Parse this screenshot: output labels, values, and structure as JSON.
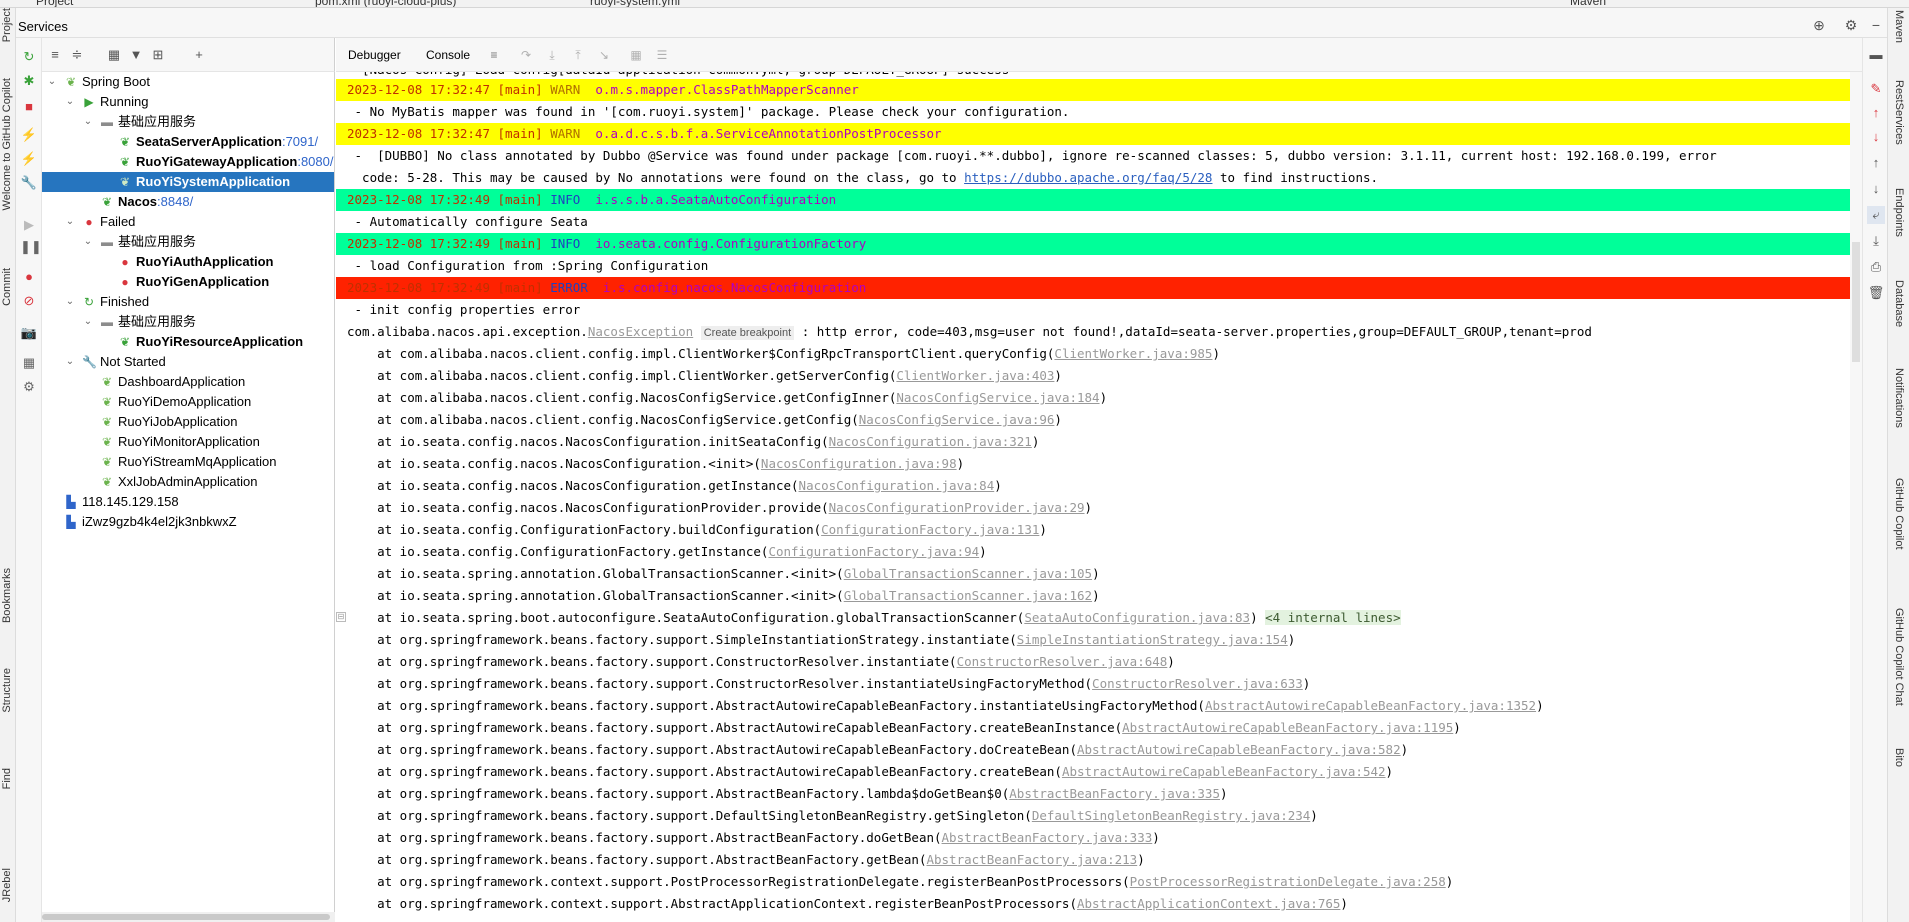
{
  "top_tabs": {
    "project": "Project",
    "pom": "pom.xml (ruoyi-cloud-plus)",
    "yml": "ruoyi-system.yml",
    "maven": "Maven"
  },
  "services": {
    "title": "Services"
  },
  "left_sidebar": {
    "project": "Project",
    "welcome": "Welcome to GitHub Copilot",
    "commit": "Commit",
    "bookmarks": "Bookmarks",
    "structure": "Structure",
    "find": "Find",
    "jrebel": "JRebel"
  },
  "right_sidebar": {
    "maven": "Maven",
    "rest": "RestServices",
    "endpoints": "Endpoints",
    "database": "Database",
    "notifications": "Notifications",
    "copilot": "GitHub Copilot",
    "copilot_chat": "GitHub Copilot Chat",
    "bito": "Bito"
  },
  "tree": {
    "spring_boot": "Spring Boot",
    "running": "Running",
    "group1": "基础应用服务",
    "seata": "SeataServerApplication",
    "seata_port": ":7091/",
    "gateway": "RuoYiGatewayApplication",
    "gateway_port": ":8080/",
    "system": "RuoYiSystemApplication",
    "nacos": "Nacos",
    "nacos_port": ":8848/",
    "failed": "Failed",
    "group2": "基础应用服务",
    "auth": "RuoYiAuthApplication",
    "gen": "RuoYiGenApplication",
    "finished": "Finished",
    "group3": "基础应用服务",
    "resource": "RuoYiResourceApplication",
    "not_started": "Not Started",
    "dashboard": "DashboardApplication",
    "demo": "RuoYiDemoApplication",
    "job": "RuoYiJobApplication",
    "monitor": "RuoYiMonitorApplication",
    "stream": "RuoYiStreamMqApplication",
    "xxl": "XxlJobAdminApplication",
    "ip": "118.145.129.158",
    "host": "iZwz9gzb4k4el2jk3nbkwxZ"
  },
  "console_tabs": {
    "debugger": "Debugger",
    "console": "Console"
  },
  "console": {
    "l0": "  [Nacos Config] Load config[dataId=application-common.yml, group=DEFAULT_GROUP] success",
    "l1_ts": "2023-12-08 17:32:47",
    "l1_thread": "[main]",
    "l1_level": "WARN",
    "l1_logger": "o.m.s.mapper.ClassPathMapperScanner",
    "l2": " - No MyBatis mapper was found in '[com.ruoyi.system]' package. Please check your configuration.",
    "l3_ts": "2023-12-08 17:32:47",
    "l3_thread": "[main]",
    "l3_level": "WARN",
    "l3_logger": "o.a.d.c.s.b.f.a.ServiceAnnotationPostProcessor",
    "l4": " -  [DUBBO] No class annotated by Dubbo @Service was found under package [com.ruoyi.**.dubbo], ignore re-scanned classes: 5, dubbo version: 3.1.11, current host: 192.168.0.199, error",
    "l5a": "  code: 5-28. This may be caused by No annotations were found on the class, go to ",
    "l5_link": "https://dubbo.apache.org/faq/5/28",
    "l5b": " to find instructions.",
    "l6_ts": "2023-12-08 17:32:49",
    "l6_thread": "[main]",
    "l6_level": "INFO",
    "l6_logger": "i.s.s.b.a.SeataAutoConfiguration",
    "l7": " - Automatically configure Seata",
    "l8_ts": "2023-12-08 17:32:49",
    "l8_thread": "[main]",
    "l8_level": "INFO",
    "l8_logger": "io.seata.config.ConfigurationFactory",
    "l9": " - load Configuration from :Spring Configuration",
    "l10_ts": "2023-12-08 17:32:49",
    "l10_thread": "[main]",
    "l10_level": "ERROR",
    "l10_logger": "i.s.config.nacos.NacosConfiguration",
    "l11": " - init config properties error",
    "exc_prefix": "com.alibaba.nacos.api.exception.",
    "exc_class": "NacosException",
    "exc_bp": "Create breakpoint",
    "exc_msg": " : http error, code=403,msg=user not found!,dataId=seata-server.properties,group=DEFAULT_GROUP,tenant=prod",
    "stack": [
      {
        "at": "    at com.alibaba.nacos.client.config.impl.ClientWorker$ConfigRpcTransportClient.queryConfig(",
        "src": "ClientWorker.java:985",
        "end": ")"
      },
      {
        "at": "    at com.alibaba.nacos.client.config.impl.ClientWorker.getServerConfig(",
        "src": "ClientWorker.java:403",
        "end": ")"
      },
      {
        "at": "    at com.alibaba.nacos.client.config.NacosConfigService.getConfigInner(",
        "src": "NacosConfigService.java:184",
        "end": ")"
      },
      {
        "at": "    at com.alibaba.nacos.client.config.NacosConfigService.getConfig(",
        "src": "NacosConfigService.java:96",
        "end": ")"
      },
      {
        "at": "    at io.seata.config.nacos.NacosConfiguration.initSeataConfig(",
        "src": "NacosConfiguration.java:321",
        "end": ")"
      },
      {
        "at": "    at io.seata.config.nacos.NacosConfiguration.<init>(",
        "src": "NacosConfiguration.java:98",
        "end": ")"
      },
      {
        "at": "    at io.seata.config.nacos.NacosConfiguration.getInstance(",
        "src": "NacosConfiguration.java:84",
        "end": ")"
      },
      {
        "at": "    at io.seata.config.nacos.NacosConfigurationProvider.provide(",
        "src": "NacosConfigurationProvider.java:29",
        "end": ")"
      },
      {
        "at": "    at io.seata.config.ConfigurationFactory.buildConfiguration(",
        "src": "ConfigurationFactory.java:131",
        "end": ")"
      },
      {
        "at": "    at io.seata.config.ConfigurationFactory.getInstance(",
        "src": "ConfigurationFactory.java:94",
        "end": ")"
      },
      {
        "at": "    at io.seata.spring.annotation.GlobalTransactionScanner.<init>(",
        "src": "GlobalTransactionScanner.java:105",
        "end": ")"
      },
      {
        "at": "    at io.seata.spring.annotation.GlobalTransactionScanner.<init>(",
        "src": "GlobalTransactionScanner.java:162",
        "end": ")"
      },
      {
        "at": "    at io.seata.spring.boot.autoconfigure.SeataAutoConfiguration.globalTransactionScanner(",
        "src": "SeataAutoConfiguration.java:83",
        "end": ") ",
        "extra": "<4 internal lines>"
      },
      {
        "at": "    at org.springframework.beans.factory.support.SimpleInstantiationStrategy.instantiate(",
        "src": "SimpleInstantiationStrategy.java:154",
        "end": ")"
      },
      {
        "at": "    at org.springframework.beans.factory.support.ConstructorResolver.instantiate(",
        "src": "ConstructorResolver.java:648",
        "end": ")"
      },
      {
        "at": "    at org.springframework.beans.factory.support.ConstructorResolver.instantiateUsingFactoryMethod(",
        "src": "ConstructorResolver.java:633",
        "end": ")"
      },
      {
        "at": "    at org.springframework.beans.factory.support.AbstractAutowireCapableBeanFactory.instantiateUsingFactoryMethod(",
        "src": "AbstractAutowireCapableBeanFactory.java:1352",
        "end": ")"
      },
      {
        "at": "    at org.springframework.beans.factory.support.AbstractAutowireCapableBeanFactory.createBeanInstance(",
        "src": "AbstractAutowireCapableBeanFactory.java:1195",
        "end": ")"
      },
      {
        "at": "    at org.springframework.beans.factory.support.AbstractAutowireCapableBeanFactory.doCreateBean(",
        "src": "AbstractAutowireCapableBeanFactory.java:582",
        "end": ")"
      },
      {
        "at": "    at org.springframework.beans.factory.support.AbstractAutowireCapableBeanFactory.createBean(",
        "src": "AbstractAutowireCapableBeanFactory.java:542",
        "end": ")"
      },
      {
        "at": "    at org.springframework.beans.factory.support.AbstractBeanFactory.lambda$doGetBean$0(",
        "src": "AbstractBeanFactory.java:335",
        "end": ")"
      },
      {
        "at": "    at org.springframework.beans.factory.support.DefaultSingletonBeanRegistry.getSingleton(",
        "src": "DefaultSingletonBeanRegistry.java:234",
        "end": ")"
      },
      {
        "at": "    at org.springframework.beans.factory.support.AbstractBeanFactory.doGetBean(",
        "src": "AbstractBeanFactory.java:333",
        "end": ")"
      },
      {
        "at": "    at org.springframework.beans.factory.support.AbstractBeanFactory.getBean(",
        "src": "AbstractBeanFactory.java:213",
        "end": ")"
      },
      {
        "at": "    at org.springframework.context.support.PostProcessorRegistrationDelegate.registerBeanPostProcessors(",
        "src": "PostProcessorRegistrationDelegate.java:258",
        "end": ")"
      },
      {
        "at": "    at org.springframework.context.support.AbstractApplicationContext.registerBeanPostProcessors(",
        "src": "AbstractApplicationContext.java:765",
        "end": ")"
      }
    ]
  },
  "colors": {
    "warn_bg": "#ffff00",
    "info_bg": "#00ff99",
    "error_bg": "#ff2200",
    "timestamp": "#c03000",
    "logger": "#b000c0",
    "warn": "#b07000",
    "info": "#2040c0",
    "error": "#2040c0",
    "link": "#2a5fbf",
    "src": "#999999",
    "selection": "#2675bf"
  },
  "icons": [
    "rerun-icon",
    "stop-icon",
    "debug-icon",
    "camera-icon",
    "gear-icon",
    "expand-all-icon",
    "collapse-all-icon",
    "group-icon",
    "filter-icon",
    "new-tab-icon",
    "add-icon",
    "spring-leaf-icon",
    "error-circle-icon",
    "wrench-icon",
    "server-icon",
    "settings-icon"
  ]
}
